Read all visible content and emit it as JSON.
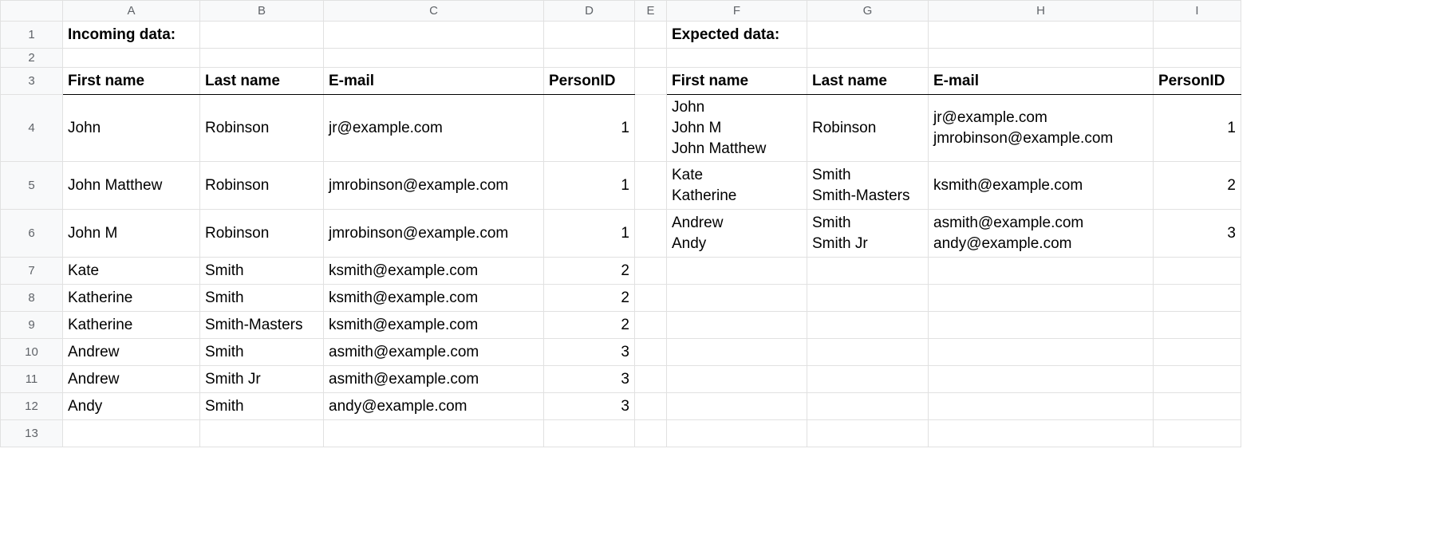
{
  "columns": [
    "A",
    "B",
    "C",
    "D",
    "E",
    "F",
    "G",
    "H",
    "I"
  ],
  "row_numbers": [
    "1",
    "2",
    "3",
    "4",
    "5",
    "6",
    "7",
    "8",
    "9",
    "10",
    "11",
    "12",
    "13"
  ],
  "section_titles": {
    "incoming": "Incoming data:",
    "expected": "Expected data:"
  },
  "headers": {
    "first_name": "First name",
    "last_name": "Last name",
    "email": "E-mail",
    "person_id": "PersonID"
  },
  "incoming_rows": [
    {
      "first": "John",
      "last": "Robinson",
      "email": "jr@example.com",
      "id": "1"
    },
    {
      "first": "John Matthew",
      "last": "Robinson",
      "email": "jmrobinson@example.com",
      "id": "1"
    },
    {
      "first": "John M",
      "last": "Robinson",
      "email": "jmrobinson@example.com",
      "id": "1"
    },
    {
      "first": "Kate",
      "last": "Smith",
      "email": "ksmith@example.com",
      "id": "2"
    },
    {
      "first": "Katherine",
      "last": "Smith",
      "email": "ksmith@example.com",
      "id": "2"
    },
    {
      "first": "Katherine",
      "last": "Smith-Masters",
      "email": "ksmith@example.com",
      "id": "2"
    },
    {
      "first": "Andrew",
      "last": "Smith",
      "email": "asmith@example.com",
      "id": "3"
    },
    {
      "first": "Andrew",
      "last": "Smith Jr",
      "email": "asmith@example.com",
      "id": "3"
    },
    {
      "first": "Andy",
      "last": "Smith",
      "email": "andy@example.com",
      "id": "3"
    }
  ],
  "expected_rows": [
    {
      "first": "John\nJohn M\nJohn Matthew",
      "last": "Robinson",
      "email": "jr@example.com\njmrobinson@example.com",
      "id": "1"
    },
    {
      "first": "Kate\nKatherine",
      "last": "Smith\nSmith-Masters",
      "email": "ksmith@example.com",
      "id": "2"
    },
    {
      "first": "Andrew\nAndy",
      "last": "Smith\nSmith Jr",
      "email": "asmith@example.com\nandy@example.com",
      "id": "3"
    }
  ]
}
